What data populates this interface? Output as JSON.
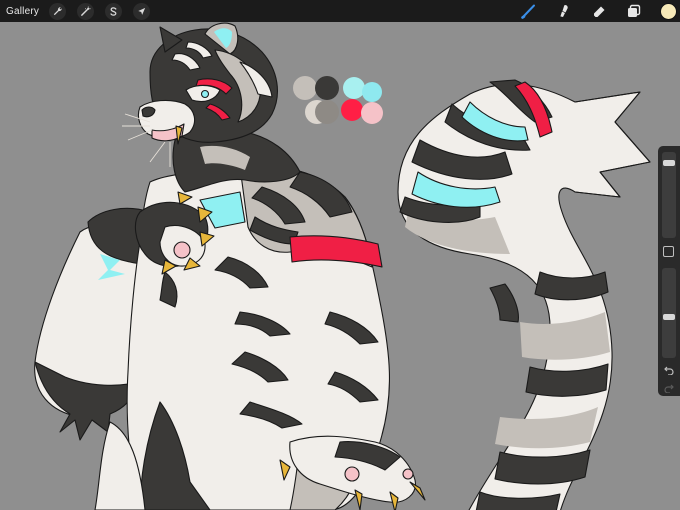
{
  "topbar": {
    "gallery_label": "Gallery",
    "left_tools": [
      {
        "name": "actions-wrench-icon"
      },
      {
        "name": "adjustments-wand-icon"
      },
      {
        "name": "selection-s-icon"
      },
      {
        "name": "transform-arrow-icon"
      }
    ],
    "right_tools": [
      {
        "name": "brush-icon",
        "active": true
      },
      {
        "name": "smudge-icon",
        "active": false
      },
      {
        "name": "eraser-icon",
        "active": false
      },
      {
        "name": "layers-icon",
        "active": false
      }
    ],
    "current_color": "#f7e9b8",
    "active_tool_color": "#3a8fe8"
  },
  "sidebar": {
    "brush_size_level": 0.1,
    "opacity_level": 0.55,
    "undo_icon": "undo-arrow-icon",
    "redo_icon": "redo-arrow-icon"
  },
  "canvas": {
    "background": "#8f8f8f",
    "palette_swatches": [
      "#c4bfb9",
      "#3a3937",
      "#dcd6cf",
      "#8e8a85",
      "#a8f0f0",
      "#ff1f45",
      "#8fe9ef",
      "#f5c2c8"
    ],
    "colors": {
      "fur_dark": "#3a3937",
      "fur_light": "#f1eeea",
      "fur_mid": "#c4bfb9",
      "accent_cyan": "#8ff0f2",
      "accent_red": "#f01f45",
      "claw_gold": "#e7b63a",
      "lineart": "#1a1a1a"
    }
  }
}
